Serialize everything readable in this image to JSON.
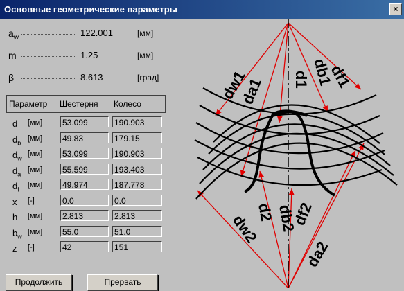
{
  "window": {
    "title": "Основные геометрические параметры",
    "close": "×"
  },
  "params": [
    {
      "label": "a",
      "sub": "w",
      "value": "122.001",
      "unit": "[мм]"
    },
    {
      "label": "m",
      "sub": "",
      "value": "1.25",
      "unit": "[мм]"
    },
    {
      "label": "β",
      "sub": "",
      "value": "8.613",
      "unit": "[град]"
    }
  ],
  "table": {
    "headers": [
      "Параметр",
      "Шестерня",
      "Колесо"
    ],
    "rows": [
      {
        "label": "d",
        "sub": "",
        "unit": "[мм]",
        "gear": "53.099",
        "wheel": "190.903"
      },
      {
        "label": "d",
        "sub": "b",
        "unit": "[мм]",
        "gear": "49.83",
        "wheel": "179.15"
      },
      {
        "label": "d",
        "sub": "w",
        "unit": "[мм]",
        "gear": "53.099",
        "wheel": "190.903"
      },
      {
        "label": "d",
        "sub": "a",
        "unit": "[мм]",
        "gear": "55.599",
        "wheel": "193.403"
      },
      {
        "label": "d",
        "sub": "f",
        "unit": "[мм]",
        "gear": "49.974",
        "wheel": "187.778"
      },
      {
        "label": "x",
        "sub": "",
        "unit": "[-]",
        "gear": "0.0",
        "wheel": "0.0"
      },
      {
        "label": "h",
        "sub": "",
        "unit": "[мм]",
        "gear": "2.813",
        "wheel": "2.813"
      },
      {
        "label": "b",
        "sub": "w",
        "unit": "[мм]",
        "gear": "55.0",
        "wheel": "51.0"
      },
      {
        "label": "z",
        "sub": "",
        "unit": "[-]",
        "gear": "42",
        "wheel": "151"
      }
    ]
  },
  "buttons": {
    "continue": "Продолжить",
    "abort": "Прервать"
  },
  "diagram": {
    "labels": {
      "dw1": "dw1",
      "da1": "da1",
      "d1": "d1",
      "db1": "db1",
      "df1": "df1",
      "d2": "d2",
      "db2": "db2",
      "dw2": "dw2",
      "df2": "df2",
      "da2": "da2"
    }
  }
}
